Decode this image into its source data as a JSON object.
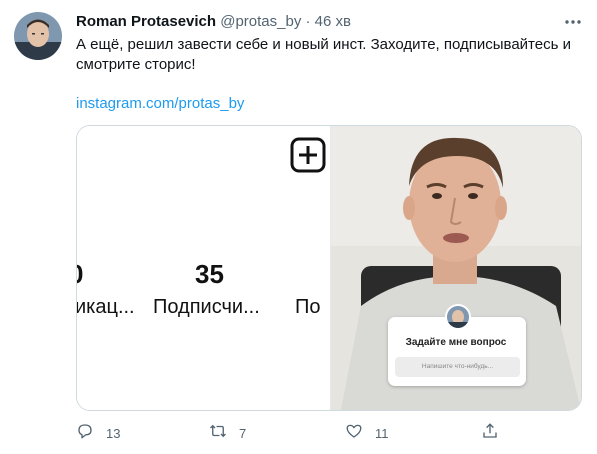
{
  "tweet": {
    "author_name": "Roman Protasevich",
    "handle": "@protas_by",
    "separator": "·",
    "time": "46 хв",
    "text": "А ещё, решил завести себе и новый инст. Заходите, подписывайтесь и смотрите сторис!",
    "link": "instagram.com/protas_by"
  },
  "media": {
    "left_panel": {
      "stat_left_partial_number": "0",
      "stat_left_partial_label": "икац...",
      "stat_center_number": "35",
      "stat_center_label": "Подписчи...",
      "stat_right_partial_label": "По"
    },
    "right_panel": {
      "question_title": "Задайте мне вопрос",
      "question_placeholder": "Напишите что-нибудь..."
    }
  },
  "actions": {
    "reply_count": "13",
    "retweet_count": "7",
    "like_count": "11"
  },
  "icons": {
    "more": "more-icon",
    "reply": "reply-icon",
    "retweet": "retweet-icon",
    "like": "like-icon",
    "share": "share-icon",
    "add_post": "plus-square-icon"
  },
  "colors": {
    "link": "#1d9bf0",
    "secondary_text": "#536471"
  }
}
